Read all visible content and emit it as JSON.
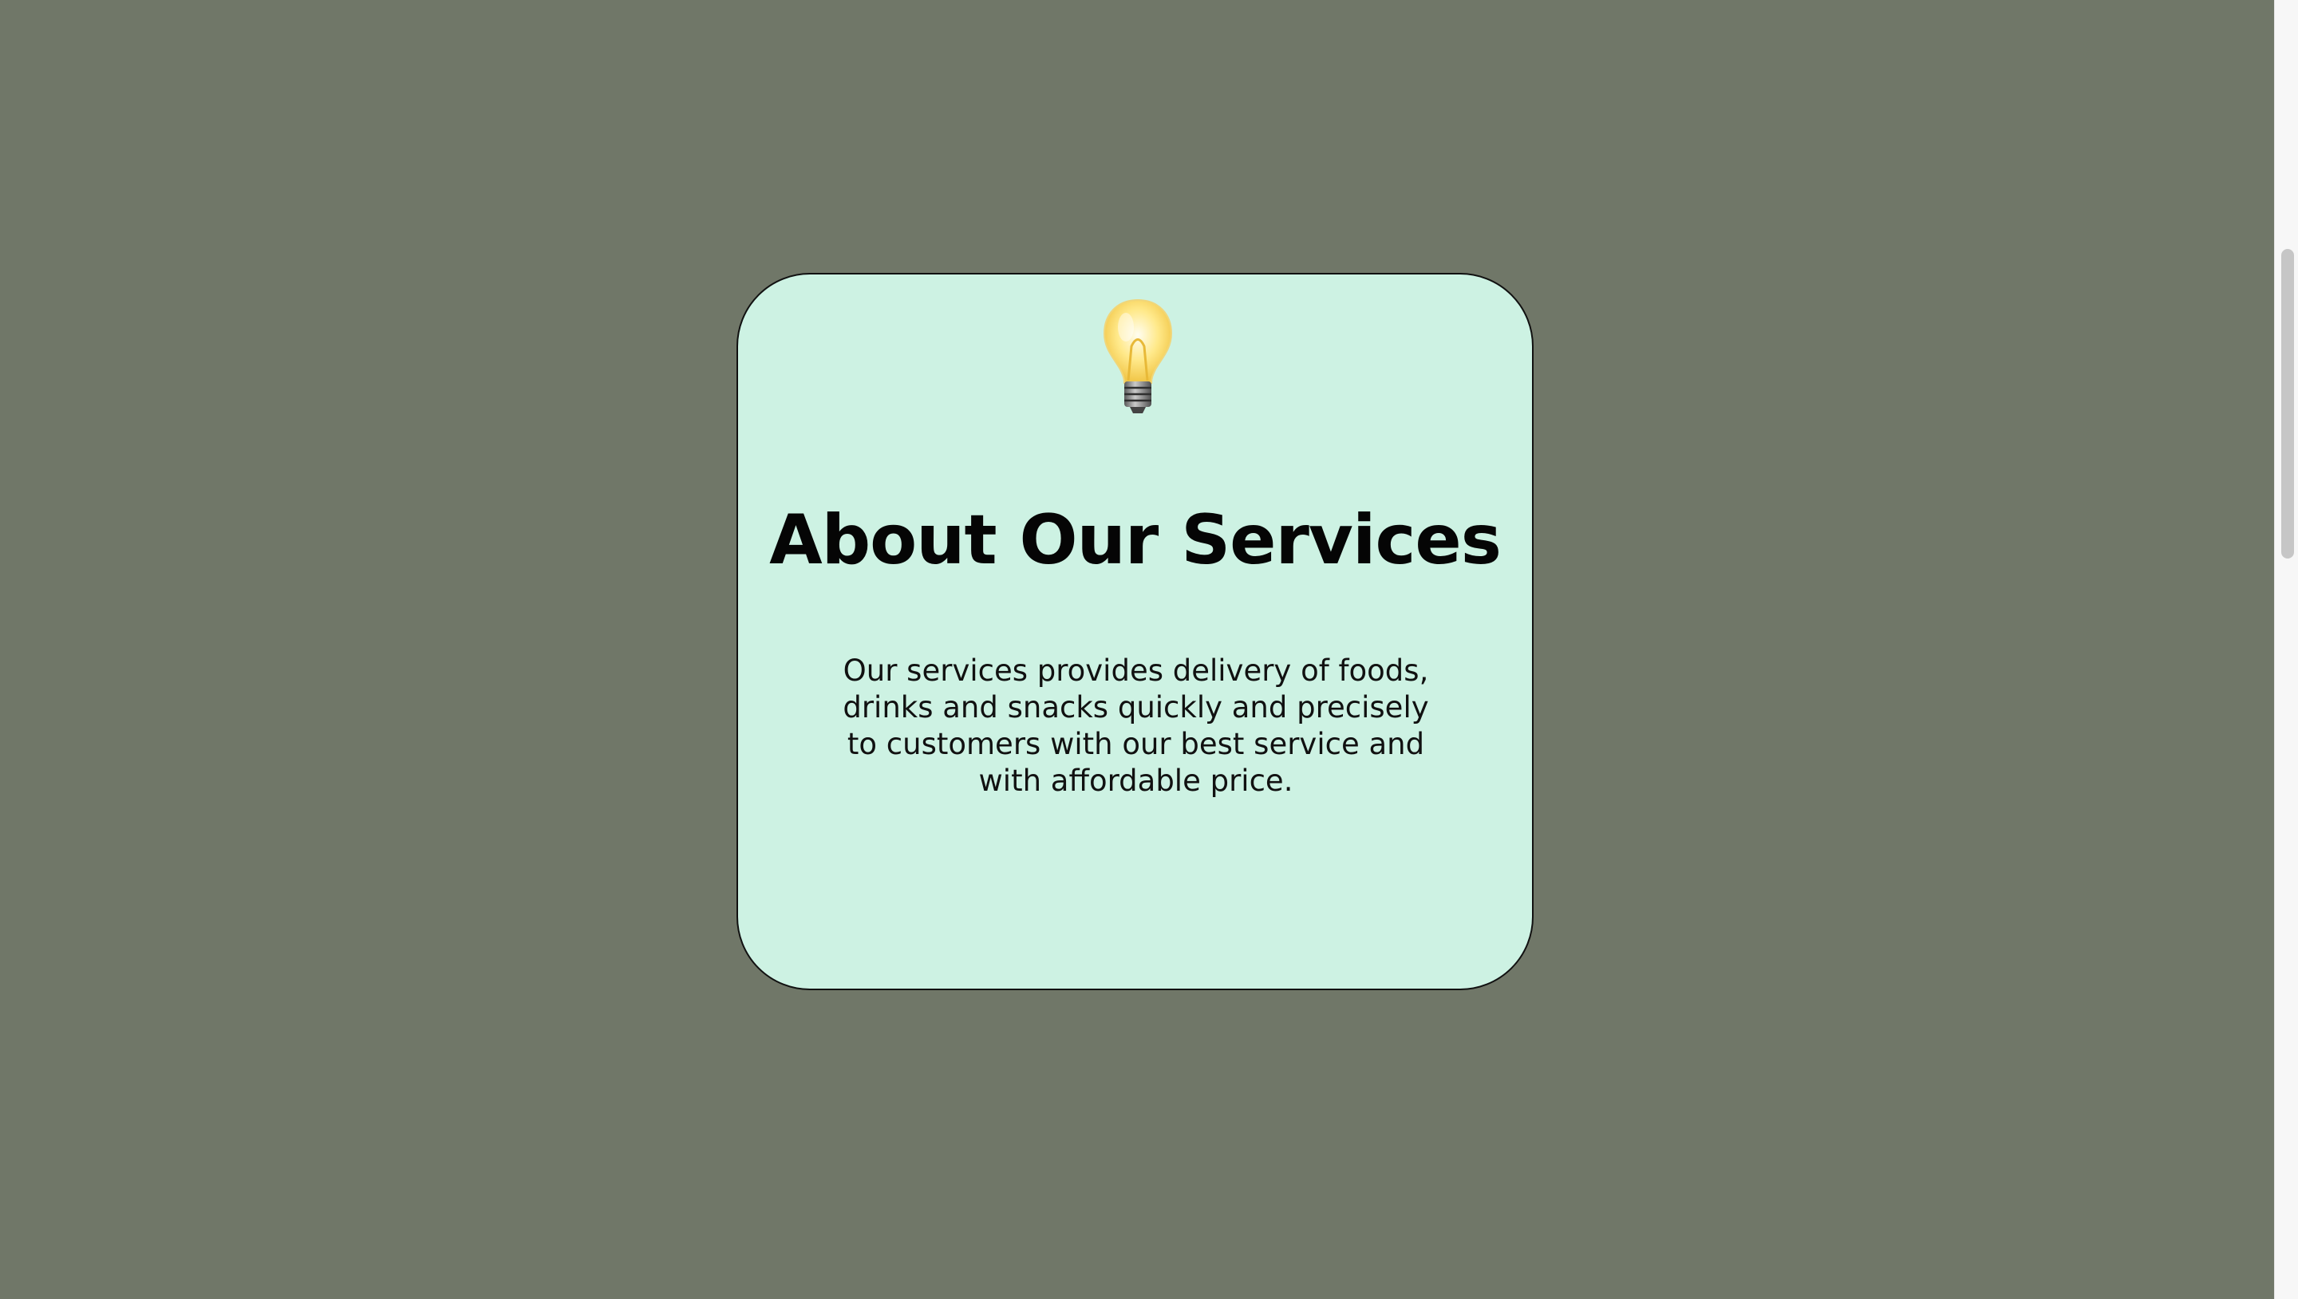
{
  "card": {
    "icon": "light-bulb-icon",
    "title": "About Our Services",
    "description": "Our services provides delivery of foods, drinks and snacks quickly and precisely to customers with our best service and with affordable price."
  },
  "colors": {
    "background": "#707768",
    "card": "#cdf2e3",
    "accent": "#2f6a3c"
  }
}
